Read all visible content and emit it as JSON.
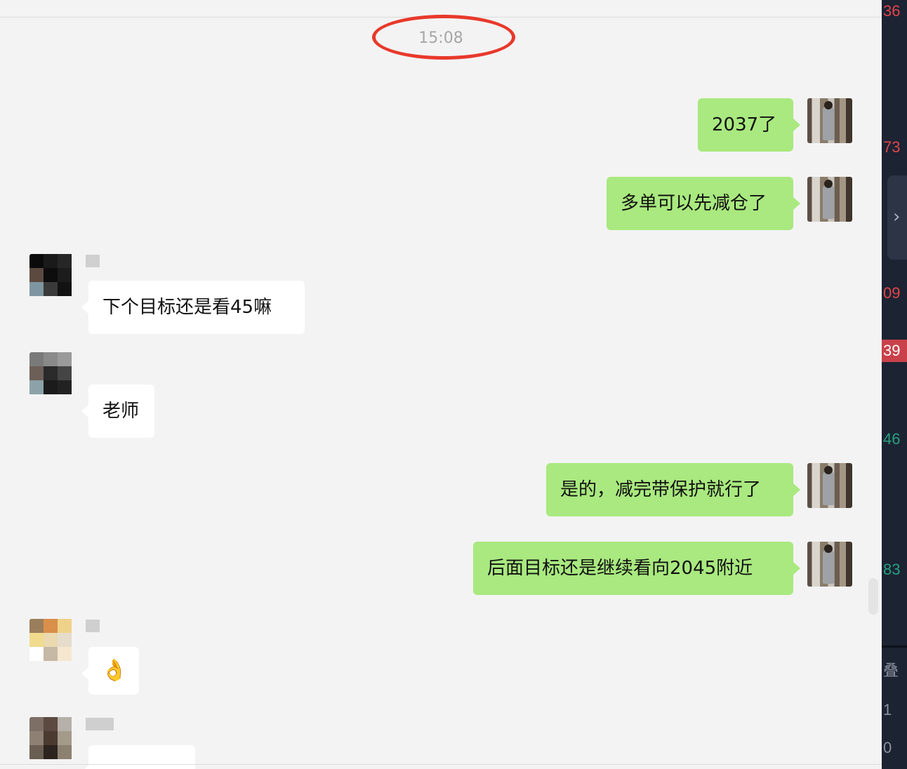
{
  "timestamp": "15:08",
  "messages": [
    {
      "dir": "out",
      "text": "2037了"
    },
    {
      "dir": "out",
      "text": "多单可以先减仓了"
    },
    {
      "dir": "in",
      "text": "下个目标还是看45嘛"
    },
    {
      "dir": "in",
      "text": "老师"
    },
    {
      "dir": "out",
      "text": "是的，减完带保护就行了"
    },
    {
      "dir": "out",
      "text": "后面目标还是继续看向2045附近"
    },
    {
      "dir": "in",
      "text": "👌"
    },
    {
      "dir": "in",
      "text": "…"
    }
  ],
  "sidebar": {
    "numbers": [
      "36",
      "73",
      "09",
      "39",
      "46",
      "83",
      "叠",
      "1",
      "0"
    ]
  },
  "colors": {
    "outgoing_bubble": "#a9e97f",
    "incoming_bubble": "#ffffff",
    "annotation_circle": "#e8392b",
    "price_up": "#e0464a",
    "price_down": "#27a27e"
  }
}
